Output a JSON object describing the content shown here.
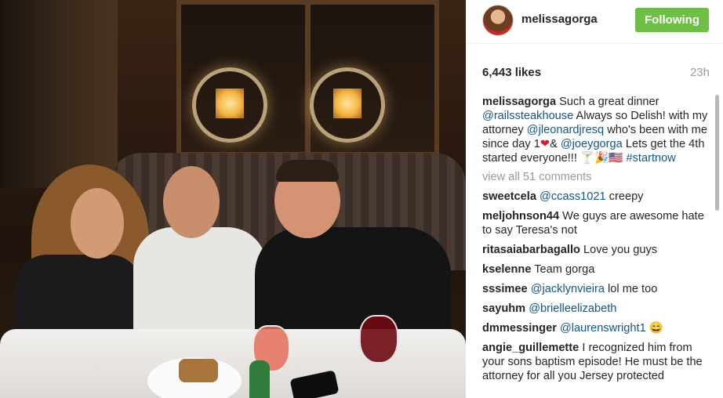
{
  "post": {
    "username": "melissagorga",
    "follow_label": "Following",
    "likes": "6,443 likes",
    "time": "23h"
  },
  "caption": {
    "user": "melissagorga",
    "t1": " Such a great dinner ",
    "m1": "@railssteakhouse",
    "t2": " Always so Delish! with my attorney ",
    "m2": "@jleonardjresq",
    "t3": " who's been with me since day 1",
    "heart": "❤",
    "t4": "& ",
    "m3": "@joeygorga",
    "t5": " Lets get the 4th started everyone!!! 🍸🎉🇺🇸 ",
    "tag": "#startnow"
  },
  "view_all": "view all 51 comments",
  "comments": [
    {
      "user": "sweetcela",
      "mention": "@ccass1021",
      "text": " creepy"
    },
    {
      "user": "meljohnson44",
      "mention": "",
      "text": " We guys are awesome hate to say Teresa's not"
    },
    {
      "user": "ritasaiabarbagallo",
      "mention": "",
      "text": " Love you guys"
    },
    {
      "user": "kselenne",
      "mention": "",
      "text": " Team gorga"
    },
    {
      "user": "sssimee",
      "mention": "@jacklynvieira",
      "text": " lol me too"
    },
    {
      "user": "sayuhm",
      "mention": "@brielleelizabeth",
      "text": ""
    },
    {
      "user": "dmmessinger",
      "mention": "@laurenswright1",
      "text": " 😄"
    },
    {
      "user": "angie_guillemette",
      "mention": "",
      "text": " I recognized him from your sons baptism episode! He must be the attorney for all you Jersey protected"
    }
  ]
}
